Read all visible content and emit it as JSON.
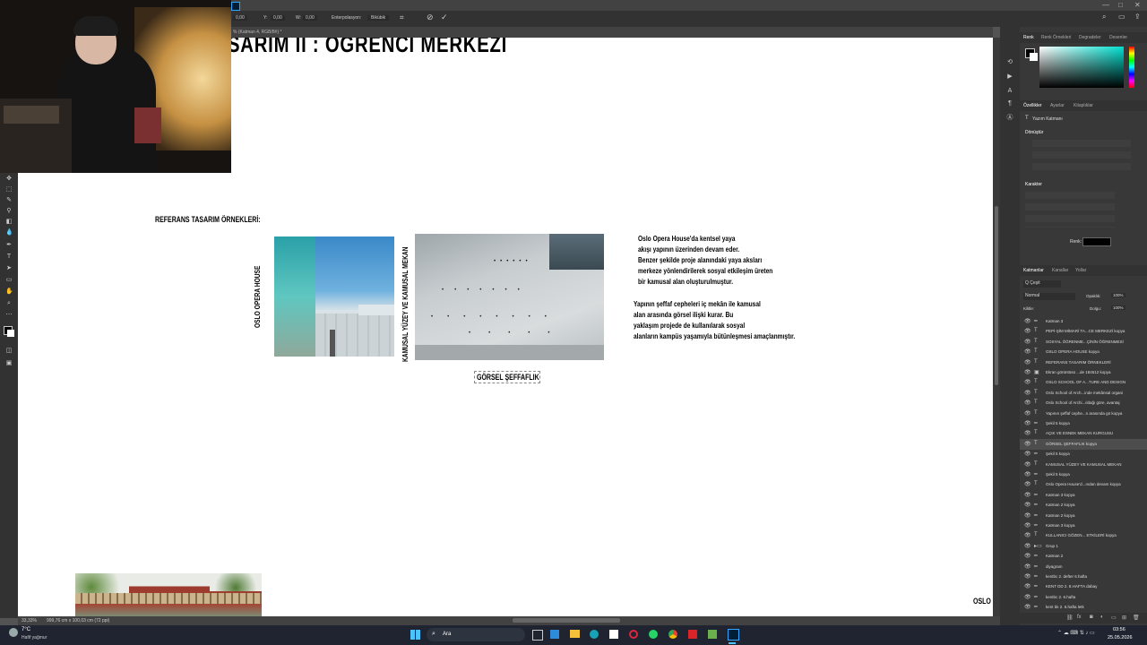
{
  "window": {
    "title_icon": "photoshop-icon",
    "controls": [
      "—",
      "□",
      "✕"
    ]
  },
  "options": {
    "x_label": "0,00",
    "y_label": "Y:",
    "y_value": "0,00",
    "w_label": "W:",
    "w_value": "0,00",
    "interp_label": "Enterpolasyon:",
    "interp_value": "Bikübik"
  },
  "tab": {
    "label": "% (Katman 4, RGB/8#) *"
  },
  "canvas": {
    "title_fragment": "SARIM II : ÖĞRENCİ MERKEZİ",
    "ref_heading": "REFERANS TASARIM ÖRNEKLERİ:",
    "vertical_label_1": "OSLO OPERA HOUSE",
    "vertical_label_2": "KAMUSAL YÜZEY VE KAMUSAL MEKAN",
    "caption": "GÖRSEL ŞEFFAFLIK",
    "para1": [
      "Oslo Opera House'da kentsel yaya",
      " akışı yapının üzerinden devam eder.",
      "Benzer şekilde proje alanındaki yaya aksları",
      "merkeze yönlendirilerek sosyal etkileşim üreten",
      "bir kamusal alan oluşturulmuştur."
    ],
    "para2": [
      "Yapının şeffaf cepheleri iç mekân ile kamusal",
      "alan arasında görsel ilişki kurar. Bu",
      " yaklaşım projede de kullanılarak sosyal",
      "alanların kampüs yaşamıyla bütünleşmesi amaçlanmıştır."
    ],
    "corner_label": "OSLO"
  },
  "status": {
    "zoom": "33,33%",
    "doc": "999,76 cm x 100,03 cm (72 ppi)"
  },
  "panel_top": {
    "tabs": [
      "Renk",
      "Renk Örnekleri",
      "Degradeler",
      "Desenler"
    ]
  },
  "props": {
    "tabs": [
      "Özellikler",
      "Ayarlar",
      "Kitaplıklar"
    ],
    "layer_type": "Yazım Katmanı",
    "transform": "Dönüştür",
    "character": "Karakter",
    "color_label": "Renk:"
  },
  "layers_panel": {
    "tabs": [
      "Katmanlar",
      "Kanallar",
      "Yollar"
    ],
    "filter": "Q Çeşit",
    "blend": "Normal",
    "opacity_label": "Opaklık:",
    "opacity": "100%",
    "lock_label": "Kilitle:",
    "fill_label": "Dolgu:",
    "fill": "100%",
    "items": [
      {
        "name": "Katman 3",
        "type": "line",
        "selected": false
      },
      {
        "name": "PEPİ-ŞİM MİMARİ TA...CE MERKEZİ kopya",
        "type": "text",
        "selected": false
      },
      {
        "name": "SOSYAL ÖĞRENME...ÇİNİN ÖĞRENMESİ",
        "type": "text",
        "selected": false
      },
      {
        "name": "OSLO OPERA HOUSE kopya",
        "type": "text",
        "selected": false
      },
      {
        "name": "REFERANS TASARIM ÖRNEKLERİ",
        "type": "text",
        "selected": false
      },
      {
        "name": "Ekran görüntüsü ...de 184512 kopya",
        "type": "image",
        "selected": false
      },
      {
        "name": "OSLO SCHOOL OF A...TURE AND DESIGN",
        "type": "text",
        "selected": false
      },
      {
        "name": "Oslo School of Arch...inde mekânsal organi",
        "type": "text",
        "selected": false
      },
      {
        "name": "Oslo School of Archi...ıldağı göre, avantaj",
        "type": "text",
        "selected": false
      },
      {
        "name": "Yapının şeffaf cephe...n arasında gö kopya",
        "type": "text",
        "selected": false
      },
      {
        "name": "Şekil 5 kopya",
        "type": "line",
        "selected": false
      },
      {
        "name": "AÇIK VE ESNEK MEKAN KURGUSU",
        "type": "text",
        "selected": false
      },
      {
        "name": "GÖRSEL ŞEFFAFLIK kopya",
        "type": "text",
        "selected": true
      },
      {
        "name": "Şekil 5 kopya",
        "type": "line",
        "selected": false
      },
      {
        "name": "KAMUSAL YÜZEY VE KAMUSAL MEKAN",
        "type": "text",
        "selected": false
      },
      {
        "name": "Şekil 5 kopya",
        "type": "line",
        "selected": false
      },
      {
        "name": "Oslo Opera House'd...ından devam kopya",
        "type": "text",
        "selected": false
      },
      {
        "name": "Katman 3 kopya",
        "type": "line",
        "selected": false
      },
      {
        "name": "Katman 2 kopya",
        "type": "line",
        "selected": false
      },
      {
        "name": "Katman 2 kopya",
        "type": "line",
        "selected": false
      },
      {
        "name": "Katman 3 kopya",
        "type": "line",
        "selected": false
      },
      {
        "name": "KULLANICI GÖZEN... ETKİLERİ kopya",
        "type": "text",
        "selected": false
      },
      {
        "name": "Grup 1",
        "type": "folder",
        "selected": false
      },
      {
        "name": "Katman 2",
        "type": "line",
        "selected": false
      },
      {
        "name": "diyagram",
        "type": "line",
        "selected": false
      },
      {
        "name": "kentbc 2. defter 6.hafta",
        "type": "line",
        "selected": false
      },
      {
        "name": "KENT DD 2. 8.HAFTA dabay",
        "type": "line",
        "selected": false
      },
      {
        "name": "kentbc 2. 6.hafta",
        "type": "line",
        "selected": false
      },
      {
        "name": "kent bk 2. 6.hafta letk",
        "type": "line",
        "selected": false
      }
    ]
  },
  "taskbar": {
    "weather_temp": "7°C",
    "weather_desc": "Hafif yağmur",
    "search": "Ara",
    "time": "03:56",
    "date": "25.05.2026",
    "apps": [
      "windows-start-icon",
      "search-icon",
      "widget-icon",
      "task-view-icon",
      "store-icon",
      "explorer-icon",
      "edge-icon",
      "chrome-icon",
      "calendar-icon",
      "opera-icon",
      "whatsapp-icon",
      "steam-icon",
      "acrobat-icon",
      "notepad-icon",
      "photoshop-icon"
    ],
    "accent": "#0078d4"
  }
}
